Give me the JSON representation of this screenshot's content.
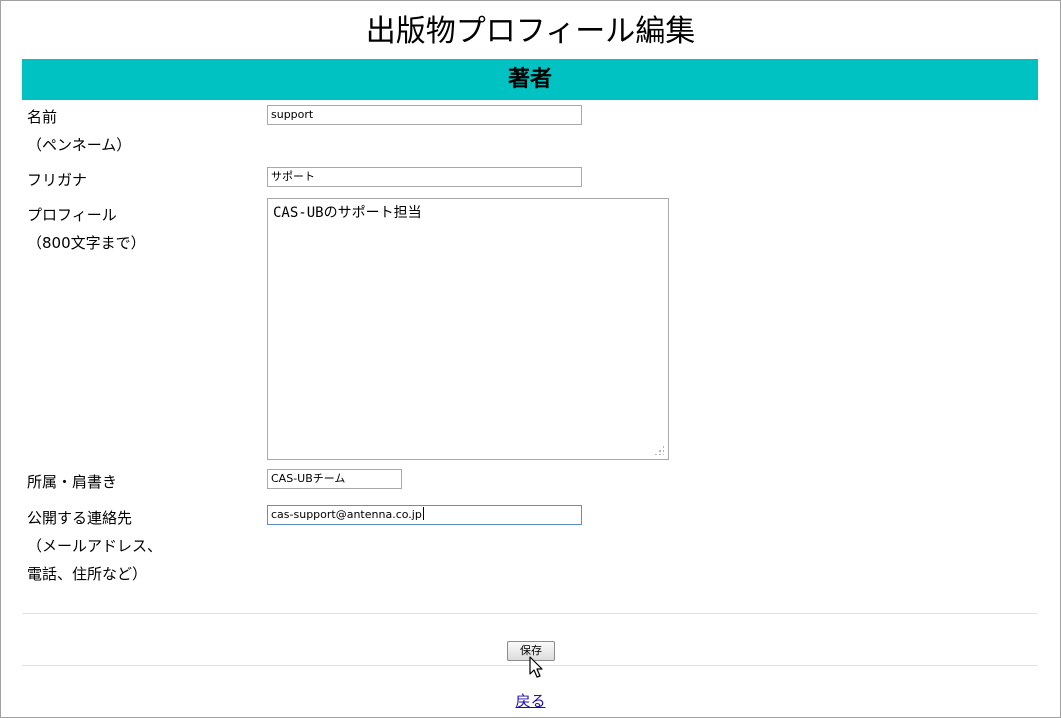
{
  "page": {
    "title": "出版物プロフィール編集"
  },
  "section": {
    "title": "著者"
  },
  "form": {
    "name_label_line1": "名前",
    "name_label_line2": "（ペンネーム）",
    "name_value": "support",
    "furigana_label": "フリガナ",
    "furigana_value": "サポート",
    "profile_label_line1": "プロフィール",
    "profile_label_line2": "（800文字まで）",
    "profile_value": "CAS-UBのサポート担当",
    "affiliation_label": "所属・肩書き",
    "affiliation_value": "CAS-UBチーム",
    "contact_label_line1": "公開する連絡先",
    "contact_label_line2": "（メールアドレス、",
    "contact_label_line3": "電話、住所など）",
    "contact_value": "cas-support@antenna.co.jp"
  },
  "actions": {
    "save_label": "保存",
    "back_label": "戻る"
  },
  "colors": {
    "section_bar": "#00c2c2",
    "link": "#1a0dab"
  },
  "icons": {
    "cursor": "mouse-pointer-icon",
    "resize": "resize-grip-icon"
  }
}
